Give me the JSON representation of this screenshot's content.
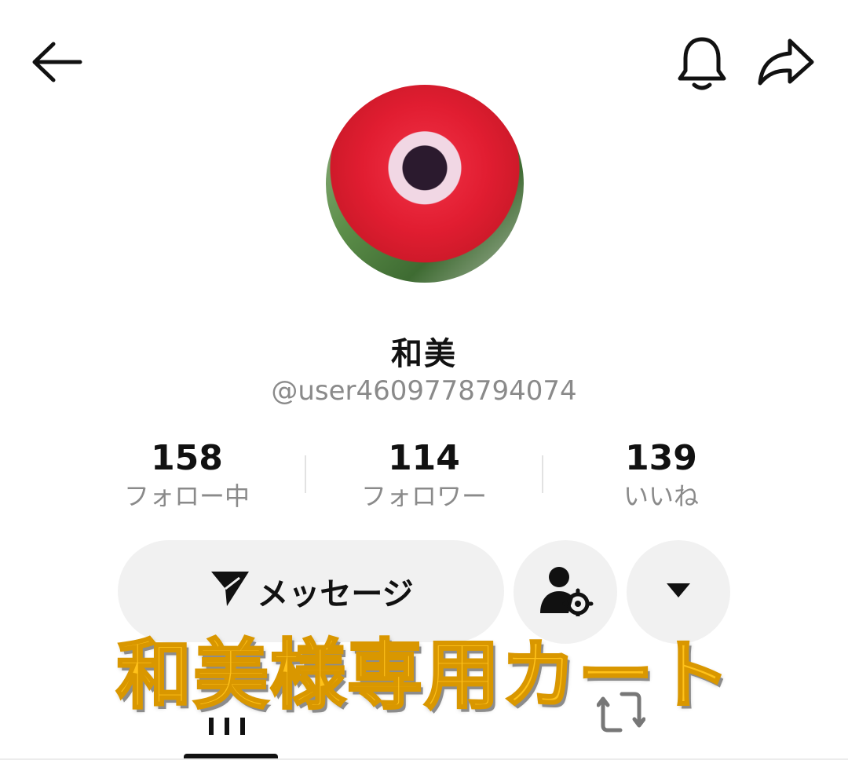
{
  "profile": {
    "display_name": "和美",
    "username": "@user4609778794074"
  },
  "stats": {
    "following": {
      "count": "158",
      "label": "フォロー中"
    },
    "followers": {
      "count": "114",
      "label": "フォロワー"
    },
    "likes": {
      "count": "139",
      "label": "いいね"
    }
  },
  "actions": {
    "message_label": "メッセージ"
  },
  "overlay": {
    "text": "和美様専用カート",
    "color": "#ffc21a"
  },
  "icons": {
    "back": "back-arrow-icon",
    "bell": "bell-icon",
    "share": "share-icon",
    "send": "send-icon",
    "friend_settings": "user-settings-icon",
    "more": "dropdown-triangle-icon",
    "videos_tab": "grid-icon",
    "reposts_tab": "repost-icon"
  }
}
